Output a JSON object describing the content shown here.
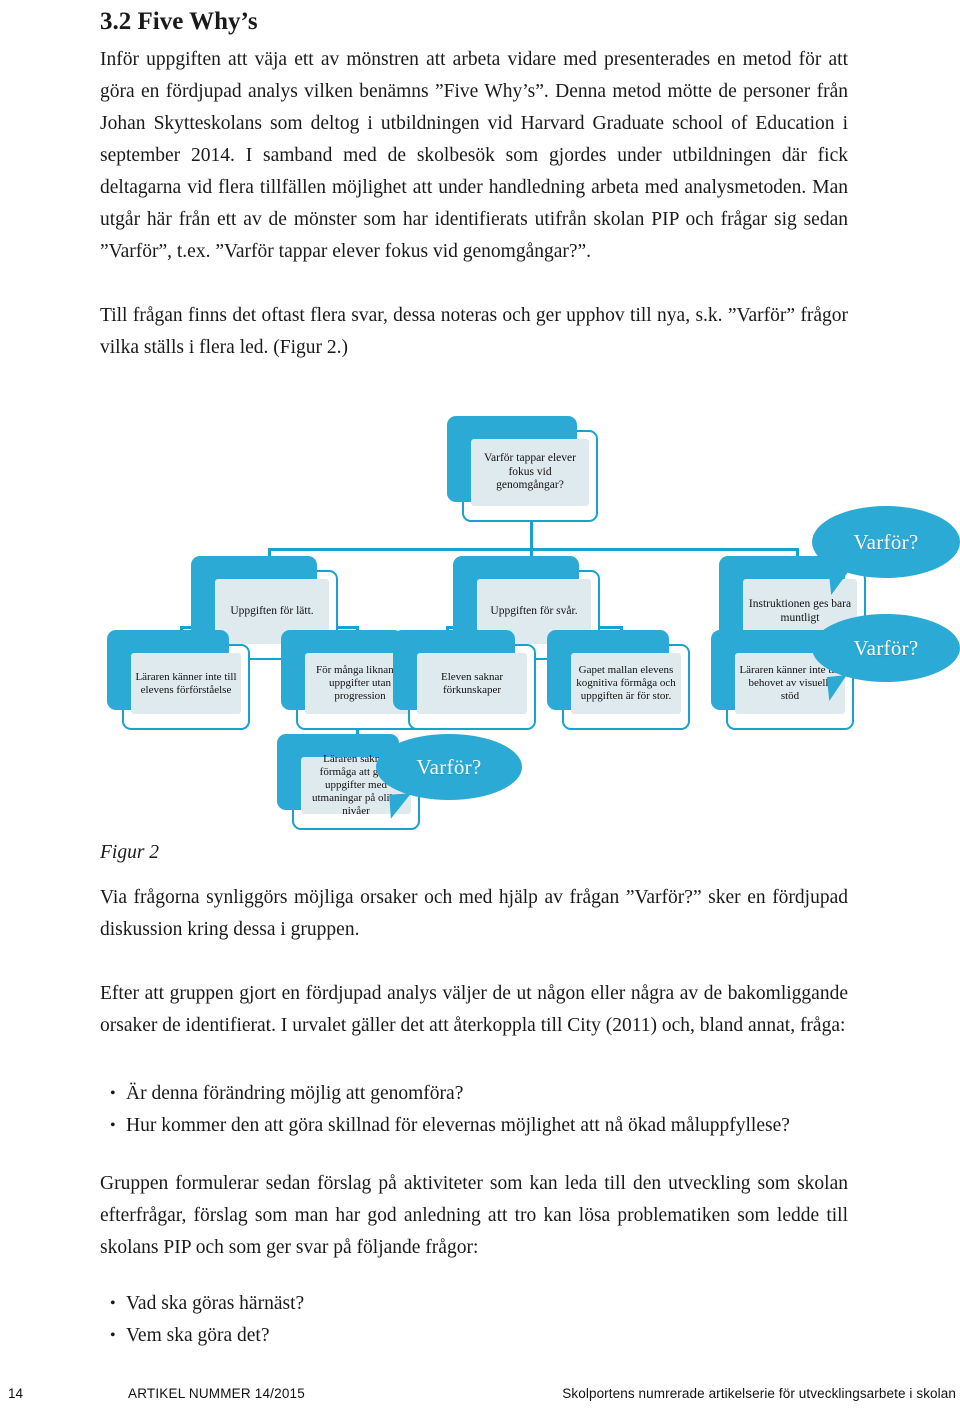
{
  "section": {
    "number_title": "3.2 Five Why’s"
  },
  "paragraphs": {
    "p1": "Inför uppgiften att väja ett av mönstren att arbeta vidare med presenterades en metod för att göra en fördjupad analys vilken benämns ”Five Why’s”. Denna metod mötte de personer från Johan Skytteskolans som deltog i utbildningen vid Harvard Graduate school of Education i september 2014. I samband med de skolbesök som gjordes under utbildningen där fick deltagarna vid flera tillfällen möjlighet att under handledning arbeta med analysmetoden. Man utgår här från ett av de mönster som har identifierats utifrån skolan PIP och frågar sig sedan ”Varför”, t.ex. ”Varför tappar elever fokus vid genomgångar?”.",
    "p2": "Till frågan finns det oftast flera svar, dessa noteras och ger upphov till nya, s.k. ”Varför” frågor vilka ställs i flera led. (Figur 2.)",
    "figure_caption": "Figur 2",
    "p3": "Via frågorna synliggörs möjliga orsaker och med hjälp av frågan ”Varför?” sker en fördjupad diskussion kring dessa i gruppen.",
    "p4": "Efter att gruppen gjort en fördjupad analys väljer de ut någon eller några av de bakomliggande orsaker de identifierat. I urvalet gäller det att återkoppla till City (2011) och, bland annat, fråga:",
    "p5": "Gruppen formulerar sedan förslag på aktiviteter som kan leda till den utveckling som skolan efterfrågar, förslag som man har god anledning att tro kan lösa problematiken som ledde till skolans PIP och som ger svar på följande frågor:"
  },
  "bullets_1": [
    "Är denna förändring möjlig att genomföra?",
    "Hur kommer den att göra skillnad för elevernas möjlighet att nå ökad måluppfyllese?"
  ],
  "bullets_2": [
    "Vad ska göras härnäst?",
    "Vem ska göra det?"
  ],
  "figure": {
    "root": "Varför tappar elever fokus vid genomgångar?",
    "level2": [
      "Uppgiften för lätt.",
      "Uppgiften för svår.",
      "Instruktionen ges bara muntligt"
    ],
    "level3": [
      "Läraren känner inte till elevens förförståelse",
      "För många liknande uppgifter utan progression",
      "Eleven saknar förkunskaper",
      "Gapet mallan elevens kognitiva förmåga och uppgiften är för stor.",
      "Läraren känner inte till behovet av visuellt stöd"
    ],
    "level4": [
      "Läraren saknar förmåga att göra uppgifter med utmaningar på olika nivåer"
    ],
    "bubbles": [
      "Varför?",
      "Varför?",
      "Varför?"
    ],
    "colors": {
      "accent_blue": "#2aaad5",
      "border_blue": "#18a3ce",
      "inner_fill": "#dfeaef",
      "node_bg": "#ffffff",
      "bubble_text": "#ffffff"
    }
  },
  "footer": {
    "page_number": "14",
    "article": "ARTIKEL NUMMER 14/2015",
    "series": "Skolportens numrerade artikelserie för utvecklingsarbete i skolan"
  }
}
